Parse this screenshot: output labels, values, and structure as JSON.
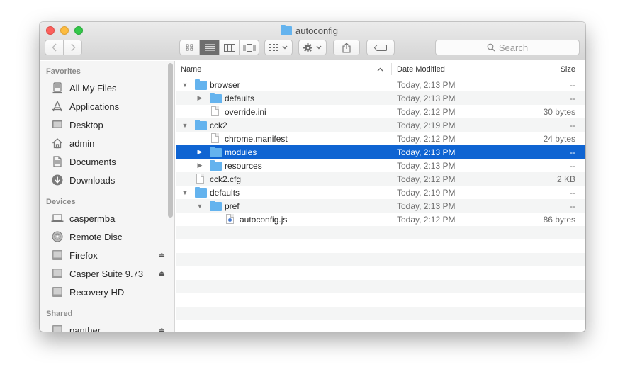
{
  "window": {
    "title": "autoconfig"
  },
  "toolbar": {
    "back_icon": "chevron-left-icon",
    "forward_icon": "chevron-right-icon",
    "view_modes": [
      "icon-view",
      "list-view",
      "column-view",
      "cover-flow-view"
    ],
    "active_view": "list-view",
    "search_placeholder": "Search"
  },
  "sidebar": {
    "favorites_label": "Favorites",
    "favorites": [
      {
        "label": "All My Files",
        "icon": "all-files-icon"
      },
      {
        "label": "Applications",
        "icon": "applications-icon"
      },
      {
        "label": "Desktop",
        "icon": "desktop-icon"
      },
      {
        "label": "admin",
        "icon": "home-icon"
      },
      {
        "label": "Documents",
        "icon": "documents-icon"
      },
      {
        "label": "Downloads",
        "icon": "downloads-icon"
      }
    ],
    "devices_label": "Devices",
    "devices": [
      {
        "label": "caspermba",
        "icon": "laptop-icon"
      },
      {
        "label": "Remote Disc",
        "icon": "disc-icon"
      },
      {
        "label": "Firefox",
        "icon": "drive-icon",
        "eject": true
      },
      {
        "label": "Casper Suite 9.73",
        "icon": "drive-icon",
        "eject": true
      },
      {
        "label": "Recovery HD",
        "icon": "drive-icon"
      }
    ],
    "shared_label": "Shared",
    "shared": [
      {
        "label": "panther",
        "icon": "server-icon",
        "eject": true
      }
    ]
  },
  "columns": {
    "name": "Name",
    "date": "Date Modified",
    "size": "Size"
  },
  "files": [
    {
      "name": "browser",
      "date": "Today, 2:13 PM",
      "size": "--",
      "depth": 0,
      "type": "folder",
      "expanded": true
    },
    {
      "name": "defaults",
      "date": "Today, 2:13 PM",
      "size": "--",
      "depth": 1,
      "type": "folder",
      "expanded": false
    },
    {
      "name": "override.ini",
      "date": "Today, 2:12 PM",
      "size": "30 bytes",
      "depth": 1,
      "type": "file"
    },
    {
      "name": "cck2",
      "date": "Today, 2:19 PM",
      "size": "--",
      "depth": 0,
      "type": "folder",
      "expanded": true
    },
    {
      "name": "chrome.manifest",
      "date": "Today, 2:12 PM",
      "size": "24 bytes",
      "depth": 1,
      "type": "file"
    },
    {
      "name": "modules",
      "date": "Today, 2:13 PM",
      "size": "--",
      "depth": 1,
      "type": "folder",
      "expanded": false,
      "selected": true
    },
    {
      "name": "resources",
      "date": "Today, 2:13 PM",
      "size": "--",
      "depth": 1,
      "type": "folder",
      "expanded": false
    },
    {
      "name": "cck2.cfg",
      "date": "Today, 2:12 PM",
      "size": "2 KB",
      "depth": 0,
      "type": "file"
    },
    {
      "name": "defaults",
      "date": "Today, 2:19 PM",
      "size": "--",
      "depth": 0,
      "type": "folder",
      "expanded": true
    },
    {
      "name": "pref",
      "date": "Today, 2:13 PM",
      "size": "--",
      "depth": 1,
      "type": "folder",
      "expanded": true
    },
    {
      "name": "autoconfig.js",
      "date": "Today, 2:12 PM",
      "size": "86 bytes",
      "depth": 2,
      "type": "js"
    }
  ],
  "colors": {
    "selection": "#0f64d2",
    "folder": "#64b3ee"
  }
}
